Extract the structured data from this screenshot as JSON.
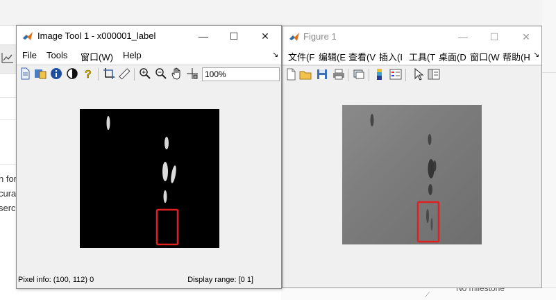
{
  "background": {
    "snippets": [
      "n for",
      "cura",
      "serc"
    ],
    "milestone_text": "No milestone"
  },
  "image_tool": {
    "title": "Image Tool 1 - x000001_label",
    "menu": {
      "file": "File",
      "tools": "Tools",
      "window": "窗口(W)",
      "help": "Help",
      "dock_arrow": "↘"
    },
    "zoom_value": "100%",
    "status": {
      "pixel_info": "Pixel info: (100, 112)  0",
      "display_range": "Display range: [0 1]"
    },
    "image_bg_color": "#000000",
    "highlight_color": "#e02020"
  },
  "figure": {
    "title": "Figure 1",
    "menu": [
      "文件(F",
      "编辑(E",
      "查看(V",
      "插入(I",
      "工具(T",
      "桌面(D",
      "窗口(W",
      "帮助(H"
    ],
    "dock_arrow": "↘",
    "image_bg_color": "#7e7e7e",
    "highlight_color": "#e02020"
  },
  "window_controls": {
    "minimize": "—",
    "maximize": "☐",
    "close": "✕"
  }
}
